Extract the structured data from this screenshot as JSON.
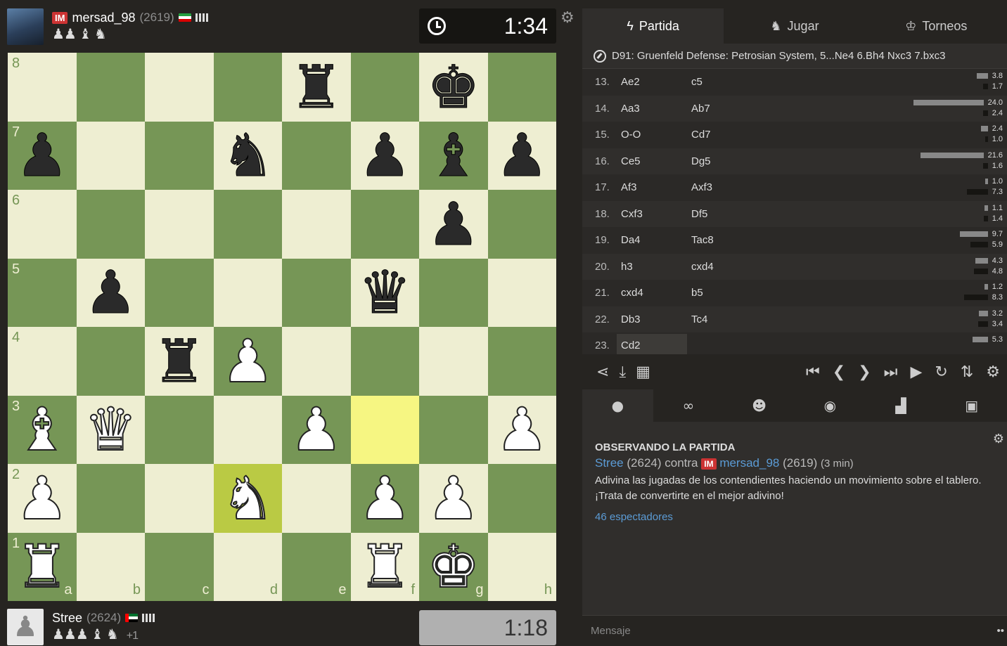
{
  "top_player": {
    "title": "IM",
    "name": "mersad_98",
    "rating": "(2619)",
    "captured": "♟♟ ♝ ♞",
    "clock": "1:34"
  },
  "bottom_player": {
    "name": "Stree",
    "rating": "(2624)",
    "captured": "♟♟♟ ♝ ♞",
    "diff": "+1",
    "clock": "1:18"
  },
  "board": {
    "ranks": [
      "8",
      "7",
      "6",
      "5",
      "4",
      "3",
      "2",
      "1"
    ],
    "files": [
      "a",
      "b",
      "c",
      "d",
      "e",
      "f",
      "g",
      "h"
    ],
    "position": [
      [
        "",
        "",
        "",
        "",
        "r",
        "",
        "k",
        ""
      ],
      [
        "p",
        "",
        "",
        "n",
        "",
        "p",
        "b",
        "p"
      ],
      [
        "",
        "",
        "",
        "",
        "",
        "",
        "p",
        ""
      ],
      [
        "",
        "p",
        "",
        "",
        "",
        "q",
        "",
        ""
      ],
      [
        "",
        "",
        "r",
        "P",
        "",
        "",
        "",
        ""
      ],
      [
        "B",
        "Q",
        "",
        "",
        "P",
        "",
        "",
        "P"
      ],
      [
        "P",
        "",
        "",
        "N",
        "",
        "P",
        "P",
        ""
      ],
      [
        "R",
        "",
        "",
        "",
        "",
        "R",
        "K",
        ""
      ]
    ],
    "highlight": [
      "f3",
      "d2"
    ]
  },
  "tabs": [
    {
      "label": "Partida",
      "icon": "lightning-icon"
    },
    {
      "label": "Jugar",
      "icon": "knight-icon"
    },
    {
      "label": "Torneos",
      "icon": "trophy-icon"
    }
  ],
  "opening": "D91: Gruenfeld Defense: Petrosian System, 5...Ne4 6.Bh4 Nxc3 7.bxc3",
  "moves": [
    {
      "n": "13.",
      "w": "Ae2",
      "b": "c5",
      "tw": "3.8",
      "tb": "1.7",
      "ww": 16,
      "wb": 7
    },
    {
      "n": "14.",
      "w": "Aa3",
      "b": "Ab7",
      "tw": "24.0",
      "tb": "2.4",
      "ww": 100,
      "wb": 7
    },
    {
      "n": "15.",
      "w": "O-O",
      "b": "Cd7",
      "tw": "2.4",
      "tb": "1.0",
      "ww": 10,
      "wb": 4
    },
    {
      "n": "16.",
      "w": "Ce5",
      "b": "Dg5",
      "tw": "21.6",
      "tb": "1.6",
      "ww": 90,
      "wb": 7
    },
    {
      "n": "17.",
      "w": "Af3",
      "b": "Axf3",
      "tw": "1.0",
      "tb": "7.3",
      "ww": 4,
      "wb": 30
    },
    {
      "n": "18.",
      "w": "Cxf3",
      "b": "Df5",
      "tw": "1.1",
      "tb": "1.4",
      "ww": 5,
      "wb": 6
    },
    {
      "n": "19.",
      "w": "Da4",
      "b": "Tac8",
      "tw": "9.7",
      "tb": "5.9",
      "ww": 40,
      "wb": 25
    },
    {
      "n": "20.",
      "w": "h3",
      "b": "cxd4",
      "tw": "4.3",
      "tb": "4.8",
      "ww": 18,
      "wb": 20
    },
    {
      "n": "21.",
      "w": "cxd4",
      "b": "b5",
      "tw": "1.2",
      "tb": "8.3",
      "ww": 5,
      "wb": 34
    },
    {
      "n": "22.",
      "w": "Db3",
      "b": "Tc4",
      "tw": "3.2",
      "tb": "3.4",
      "ww": 13,
      "wb": 14
    },
    {
      "n": "23.",
      "w": "Cd2",
      "b": "",
      "tw": "5.3",
      "tb": "",
      "ww": 22,
      "wb": 0
    }
  ],
  "watch": {
    "title": "OBSERVANDO LA PARTIDA",
    "white_name": "Stree",
    "white_rating": "(2624)",
    "contra": "contra",
    "black_title": "IM",
    "black_name": "mersad_98",
    "black_rating": "(2619)",
    "tc": "(3 min)",
    "text": "Adivina las jugadas de los contendientes haciendo un movimiento sobre el tablero. ¡Trata de convertirte en el mejor adivino!",
    "spectators": "46 espectadores"
  },
  "message_placeholder": "Mensaje"
}
